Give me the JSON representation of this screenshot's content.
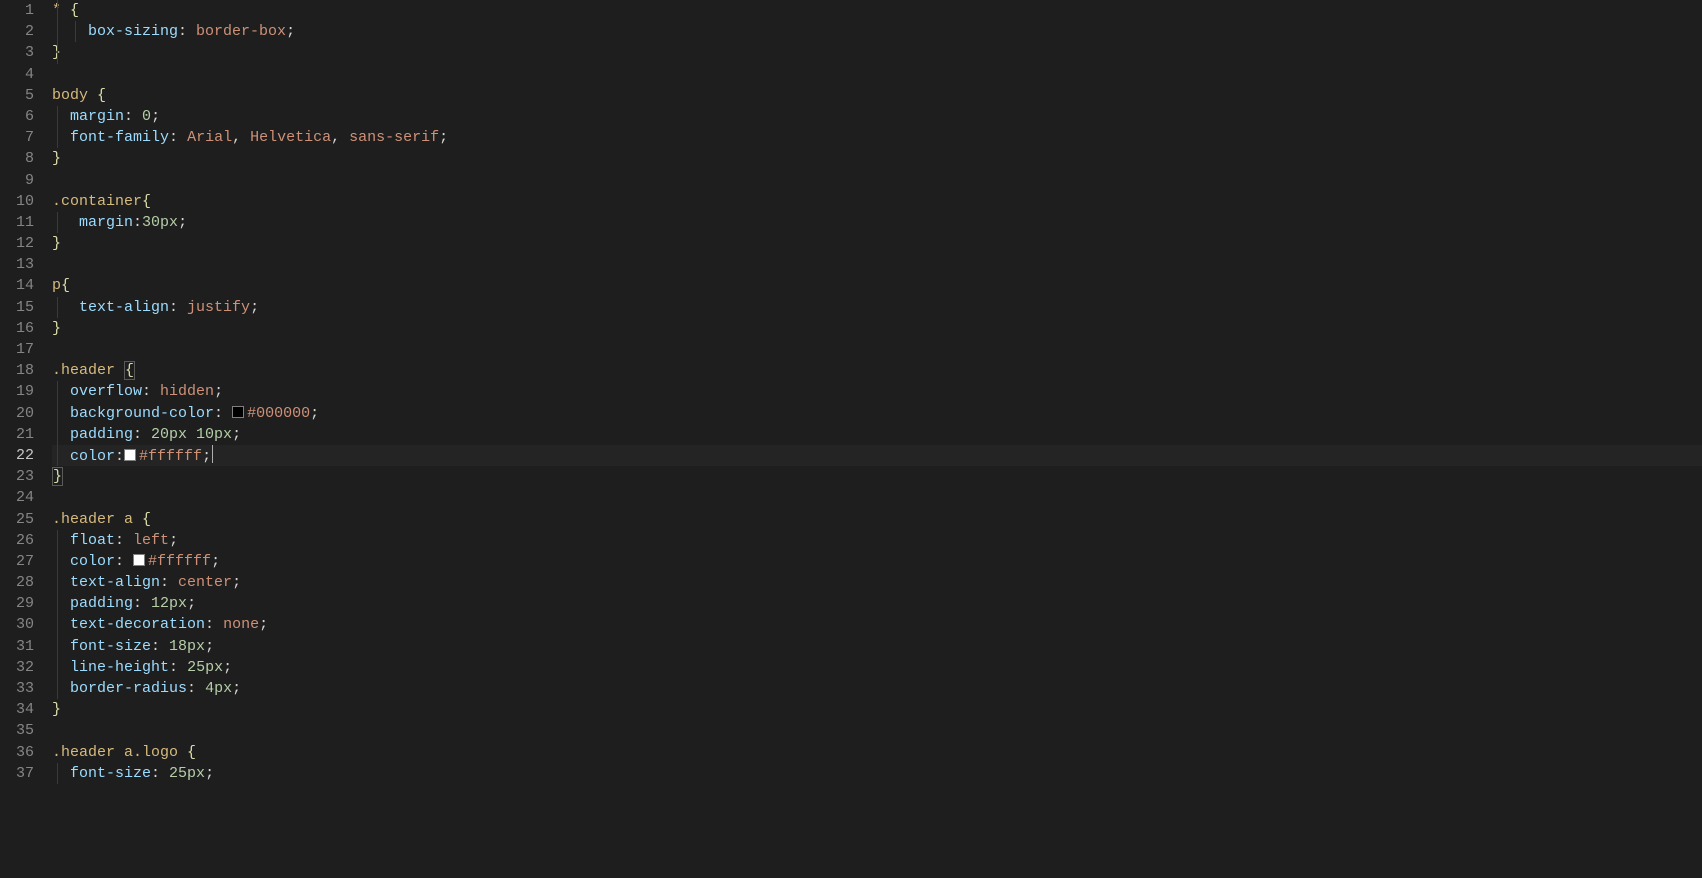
{
  "editor": {
    "activeLine": 22,
    "lineNumbers": [
      "1",
      "2",
      "3",
      "4",
      "5",
      "6",
      "7",
      "8",
      "9",
      "10",
      "11",
      "12",
      "13",
      "14",
      "15",
      "16",
      "17",
      "18",
      "19",
      "20",
      "21",
      "22",
      "23",
      "24",
      "25",
      "26",
      "27",
      "28",
      "29",
      "30",
      "31",
      "32",
      "33",
      "34",
      "35",
      "36",
      "37"
    ],
    "lines": [
      {
        "indent": 1,
        "segs": [
          {
            "t": "* ",
            "c": "tok-sel"
          },
          {
            "t": "{",
            "c": "tok-brace"
          }
        ]
      },
      {
        "indent": 2,
        "segs": [
          {
            "t": "    ",
            "c": ""
          },
          {
            "t": "box-sizing",
            "c": "tok-prop"
          },
          {
            "t": ": ",
            "c": "tok-punc"
          },
          {
            "t": "border-box",
            "c": "tok-val"
          },
          {
            "t": ";",
            "c": "tok-punc"
          }
        ]
      },
      {
        "indent": 1,
        "segs": [
          {
            "t": "}",
            "c": "tok-brace"
          }
        ]
      },
      {
        "indent": 0,
        "segs": []
      },
      {
        "indent": 0,
        "segs": [
          {
            "t": "body ",
            "c": "tok-sel"
          },
          {
            "t": "{",
            "c": "tok-brace"
          }
        ]
      },
      {
        "indent": 1,
        "segs": [
          {
            "t": "  ",
            "c": ""
          },
          {
            "t": "margin",
            "c": "tok-prop"
          },
          {
            "t": ": ",
            "c": "tok-punc"
          },
          {
            "t": "0",
            "c": "tok-num"
          },
          {
            "t": ";",
            "c": "tok-punc"
          }
        ]
      },
      {
        "indent": 1,
        "segs": [
          {
            "t": "  ",
            "c": ""
          },
          {
            "t": "font-family",
            "c": "tok-prop"
          },
          {
            "t": ": ",
            "c": "tok-punc"
          },
          {
            "t": "Arial",
            "c": "tok-val"
          },
          {
            "t": ", ",
            "c": "tok-punc"
          },
          {
            "t": "Helvetica",
            "c": "tok-val"
          },
          {
            "t": ", ",
            "c": "tok-punc"
          },
          {
            "t": "sans-serif",
            "c": "tok-val"
          },
          {
            "t": ";",
            "c": "tok-punc"
          }
        ]
      },
      {
        "indent": 0,
        "segs": [
          {
            "t": "}",
            "c": "tok-brace"
          }
        ]
      },
      {
        "indent": 0,
        "segs": []
      },
      {
        "indent": 0,
        "segs": [
          {
            "t": ".container",
            "c": "tok-sel"
          },
          {
            "t": "{",
            "c": "tok-brace"
          }
        ]
      },
      {
        "indent": 1,
        "segs": [
          {
            "t": "   ",
            "c": ""
          },
          {
            "t": "margin",
            "c": "tok-prop"
          },
          {
            "t": ":",
            "c": "tok-punc"
          },
          {
            "t": "30px",
            "c": "tok-num"
          },
          {
            "t": ";",
            "c": "tok-punc"
          }
        ]
      },
      {
        "indent": 0,
        "segs": [
          {
            "t": "}",
            "c": "tok-brace"
          }
        ]
      },
      {
        "indent": 0,
        "segs": []
      },
      {
        "indent": 0,
        "segs": [
          {
            "t": "p",
            "c": "tok-sel"
          },
          {
            "t": "{",
            "c": "tok-brace"
          }
        ]
      },
      {
        "indent": 1,
        "segs": [
          {
            "t": "   ",
            "c": ""
          },
          {
            "t": "text-align",
            "c": "tok-prop"
          },
          {
            "t": ": ",
            "c": "tok-punc"
          },
          {
            "t": "justify",
            "c": "tok-val"
          },
          {
            "t": ";",
            "c": "tok-punc"
          }
        ]
      },
      {
        "indent": 0,
        "segs": [
          {
            "t": "}",
            "c": "tok-brace"
          }
        ]
      },
      {
        "indent": 0,
        "segs": []
      },
      {
        "indent": 0,
        "segs": [
          {
            "t": ".header ",
            "c": "tok-sel"
          },
          {
            "t": "{",
            "c": "tok-brace",
            "box": true
          }
        ]
      },
      {
        "indent": 1,
        "segs": [
          {
            "t": "  ",
            "c": ""
          },
          {
            "t": "overflow",
            "c": "tok-prop"
          },
          {
            "t": ": ",
            "c": "tok-punc"
          },
          {
            "t": "hidden",
            "c": "tok-val"
          },
          {
            "t": ";",
            "c": "tok-punc"
          }
        ]
      },
      {
        "indent": 1,
        "segs": [
          {
            "t": "  ",
            "c": ""
          },
          {
            "t": "background-color",
            "c": "tok-prop"
          },
          {
            "t": ": ",
            "c": "tok-punc"
          },
          {
            "color": "#000000"
          },
          {
            "t": "#000000",
            "c": "tok-val"
          },
          {
            "t": ";",
            "c": "tok-punc"
          }
        ]
      },
      {
        "indent": 1,
        "segs": [
          {
            "t": "  ",
            "c": ""
          },
          {
            "t": "padding",
            "c": "tok-prop"
          },
          {
            "t": ": ",
            "c": "tok-punc"
          },
          {
            "t": "20px 10px",
            "c": "tok-num"
          },
          {
            "t": ";",
            "c": "tok-punc"
          }
        ]
      },
      {
        "indent": 1,
        "active": true,
        "segs": [
          {
            "t": "  ",
            "c": ""
          },
          {
            "t": "color",
            "c": "tok-prop"
          },
          {
            "t": ":",
            "c": "tok-punc"
          },
          {
            "color": "#ffffff"
          },
          {
            "t": "#ffffff",
            "c": "tok-val"
          },
          {
            "t": ";",
            "c": "tok-punc"
          },
          {
            "cursor": true
          }
        ]
      },
      {
        "indent": 0,
        "segs": [
          {
            "t": "}",
            "c": "tok-brace",
            "box": true
          }
        ]
      },
      {
        "indent": 0,
        "segs": []
      },
      {
        "indent": 0,
        "segs": [
          {
            "t": ".header a ",
            "c": "tok-sel"
          },
          {
            "t": "{",
            "c": "tok-brace"
          }
        ]
      },
      {
        "indent": 1,
        "segs": [
          {
            "t": "  ",
            "c": ""
          },
          {
            "t": "float",
            "c": "tok-prop"
          },
          {
            "t": ": ",
            "c": "tok-punc"
          },
          {
            "t": "left",
            "c": "tok-val"
          },
          {
            "t": ";",
            "c": "tok-punc"
          }
        ]
      },
      {
        "indent": 1,
        "segs": [
          {
            "t": "  ",
            "c": ""
          },
          {
            "t": "color",
            "c": "tok-prop"
          },
          {
            "t": ": ",
            "c": "tok-punc"
          },
          {
            "color": "#ffffff"
          },
          {
            "t": "#ffffff",
            "c": "tok-val"
          },
          {
            "t": ";",
            "c": "tok-punc"
          }
        ]
      },
      {
        "indent": 1,
        "segs": [
          {
            "t": "  ",
            "c": ""
          },
          {
            "t": "text-align",
            "c": "tok-prop"
          },
          {
            "t": ": ",
            "c": "tok-punc"
          },
          {
            "t": "center",
            "c": "tok-val"
          },
          {
            "t": ";",
            "c": "tok-punc"
          }
        ]
      },
      {
        "indent": 1,
        "segs": [
          {
            "t": "  ",
            "c": ""
          },
          {
            "t": "padding",
            "c": "tok-prop"
          },
          {
            "t": ": ",
            "c": "tok-punc"
          },
          {
            "t": "12px",
            "c": "tok-num"
          },
          {
            "t": ";",
            "c": "tok-punc"
          }
        ]
      },
      {
        "indent": 1,
        "segs": [
          {
            "t": "  ",
            "c": ""
          },
          {
            "t": "text-decoration",
            "c": "tok-prop"
          },
          {
            "t": ": ",
            "c": "tok-punc"
          },
          {
            "t": "none",
            "c": "tok-val"
          },
          {
            "t": ";",
            "c": "tok-punc"
          }
        ]
      },
      {
        "indent": 1,
        "segs": [
          {
            "t": "  ",
            "c": ""
          },
          {
            "t": "font-size",
            "c": "tok-prop"
          },
          {
            "t": ": ",
            "c": "tok-punc"
          },
          {
            "t": "18px",
            "c": "tok-num"
          },
          {
            "t": ";",
            "c": "tok-punc"
          }
        ]
      },
      {
        "indent": 1,
        "segs": [
          {
            "t": "  ",
            "c": ""
          },
          {
            "t": "line-height",
            "c": "tok-prop"
          },
          {
            "t": ": ",
            "c": "tok-punc"
          },
          {
            "t": "25px",
            "c": "tok-num"
          },
          {
            "t": ";",
            "c": "tok-punc"
          }
        ]
      },
      {
        "indent": 1,
        "segs": [
          {
            "t": "  ",
            "c": ""
          },
          {
            "t": "border-radius",
            "c": "tok-prop"
          },
          {
            "t": ": ",
            "c": "tok-punc"
          },
          {
            "t": "4px",
            "c": "tok-num"
          },
          {
            "t": ";",
            "c": "tok-punc"
          }
        ]
      },
      {
        "indent": 0,
        "segs": [
          {
            "t": "}",
            "c": "tok-brace"
          }
        ]
      },
      {
        "indent": 0,
        "segs": []
      },
      {
        "indent": 0,
        "segs": [
          {
            "t": ".header a.logo ",
            "c": "tok-sel"
          },
          {
            "t": "{",
            "c": "tok-brace"
          }
        ]
      },
      {
        "indent": 1,
        "segs": [
          {
            "t": "  ",
            "c": ""
          },
          {
            "t": "font-size",
            "c": "tok-prop"
          },
          {
            "t": ": ",
            "c": "tok-punc"
          },
          {
            "t": "25px",
            "c": "tok-num"
          },
          {
            "t": ";",
            "c": "tok-punc"
          }
        ]
      }
    ]
  }
}
